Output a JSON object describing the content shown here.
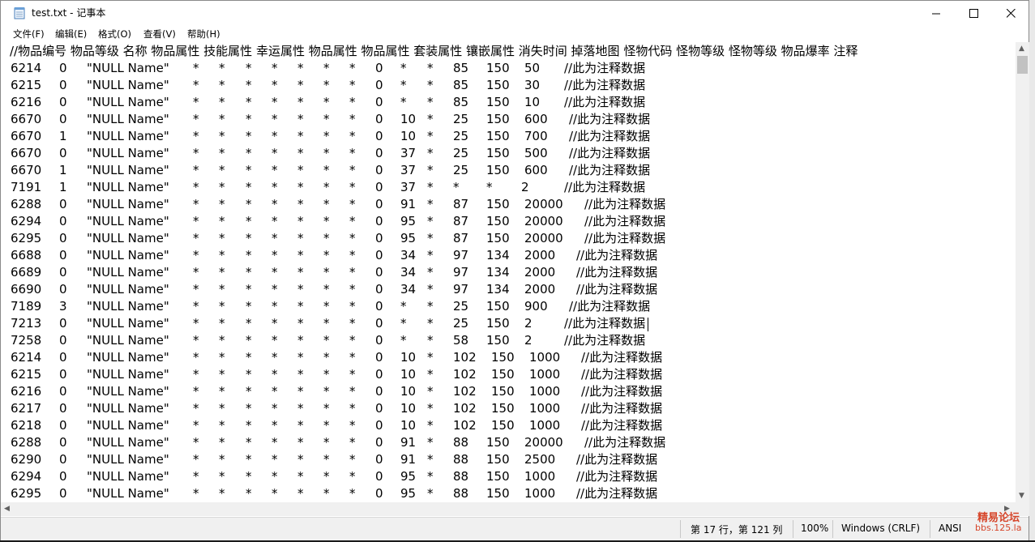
{
  "window": {
    "title": "test.txt - 记事本",
    "controls": {
      "minimize": "minimize-icon",
      "maximize": "maximize-icon",
      "close": "close-icon"
    }
  },
  "menu": [
    "文件(F)",
    "编辑(E)",
    "格式(O)",
    "查看(V)",
    "帮助(H)"
  ],
  "header_line": "//物品编号 物品等级 名称 物品属性 技能属性 幸运属性 物品属性 物品属性 套装属性 镶嵌属性 消失时间 掉落地图 怪物代码 怪物等级 怪物等级 物品爆率 注释",
  "rows": [
    [
      "6214",
      "0",
      "\"NULL Name\"",
      "*",
      "*",
      "*",
      "*",
      "*",
      "*",
      "*",
      "0",
      "*",
      "*",
      "85",
      "150",
      "50",
      "//此为注释数据"
    ],
    [
      "6215",
      "0",
      "\"NULL Name\"",
      "*",
      "*",
      "*",
      "*",
      "*",
      "*",
      "*",
      "0",
      "*",
      "*",
      "85",
      "150",
      "30",
      "//此为注释数据"
    ],
    [
      "6216",
      "0",
      "\"NULL Name\"",
      "*",
      "*",
      "*",
      "*",
      "*",
      "*",
      "*",
      "0",
      "*",
      "*",
      "85",
      "150",
      "10",
      "//此为注释数据"
    ],
    [
      "6670",
      "0",
      "\"NULL Name\"",
      "*",
      "*",
      "*",
      "*",
      "*",
      "*",
      "*",
      "0",
      "10",
      "*",
      "25",
      "150",
      "600",
      "//此为注释数据"
    ],
    [
      "6670",
      "1",
      "\"NULL Name\"",
      "*",
      "*",
      "*",
      "*",
      "*",
      "*",
      "*",
      "0",
      "10",
      "*",
      "25",
      "150",
      "700",
      "//此为注释数据"
    ],
    [
      "6670",
      "0",
      "\"NULL Name\"",
      "*",
      "*",
      "*",
      "*",
      "*",
      "*",
      "*",
      "0",
      "37",
      "*",
      "25",
      "150",
      "500",
      "//此为注释数据"
    ],
    [
      "6670",
      "1",
      "\"NULL Name\"",
      "*",
      "*",
      "*",
      "*",
      "*",
      "*",
      "*",
      "0",
      "37",
      "*",
      "25",
      "150",
      "600",
      "//此为注释数据"
    ],
    [
      "7191",
      "1",
      "\"NULL Name\"",
      "*",
      "*",
      "*",
      "*",
      "*",
      "*",
      "*",
      "0",
      "37",
      "*",
      "*",
      "*",
      "2",
      "//此为注释数据"
    ],
    [
      "6288",
      "0",
      "\"NULL Name\"",
      "*",
      "*",
      "*",
      "*",
      "*",
      "*",
      "*",
      "0",
      "91",
      "*",
      "87",
      "150",
      "20000",
      "//此为注释数据"
    ],
    [
      "6294",
      "0",
      "\"NULL Name\"",
      "*",
      "*",
      "*",
      "*",
      "*",
      "*",
      "*",
      "0",
      "95",
      "*",
      "87",
      "150",
      "20000",
      "//此为注释数据"
    ],
    [
      "6295",
      "0",
      "\"NULL Name\"",
      "*",
      "*",
      "*",
      "*",
      "*",
      "*",
      "*",
      "0",
      "95",
      "*",
      "87",
      "150",
      "20000",
      "//此为注释数据"
    ],
    [
      "6688",
      "0",
      "\"NULL Name\"",
      "*",
      "*",
      "*",
      "*",
      "*",
      "*",
      "*",
      "0",
      "34",
      "*",
      "97",
      "134",
      "2000",
      "//此为注释数据"
    ],
    [
      "6689",
      "0",
      "\"NULL Name\"",
      "*",
      "*",
      "*",
      "*",
      "*",
      "*",
      "*",
      "0",
      "34",
      "*",
      "97",
      "134",
      "2000",
      "//此为注释数据"
    ],
    [
      "6690",
      "0",
      "\"NULL Name\"",
      "*",
      "*",
      "*",
      "*",
      "*",
      "*",
      "*",
      "0",
      "34",
      "*",
      "97",
      "134",
      "2000",
      "//此为注释数据"
    ],
    [
      "7189",
      "3",
      "\"NULL Name\"",
      "*",
      "*",
      "*",
      "*",
      "*",
      "*",
      "*",
      "0",
      "*",
      "*",
      "25",
      "150",
      "900",
      "//此为注释数据"
    ],
    [
      "7213",
      "0",
      "\"NULL Name\"",
      "*",
      "*",
      "*",
      "*",
      "*",
      "*",
      "*",
      "0",
      "*",
      "*",
      "25",
      "150",
      "2",
      "//此为注释数据"
    ],
    [
      "7258",
      "0",
      "\"NULL Name\"",
      "*",
      "*",
      "*",
      "*",
      "*",
      "*",
      "*",
      "0",
      "*",
      "*",
      "58",
      "150",
      "2",
      "//此为注释数据"
    ],
    [
      "6214",
      "0",
      "\"NULL Name\"",
      "*",
      "*",
      "*",
      "*",
      "*",
      "*",
      "*",
      "0",
      "10",
      "*",
      "102",
      "150",
      "1000",
      "//此为注释数据"
    ],
    [
      "6215",
      "0",
      "\"NULL Name\"",
      "*",
      "*",
      "*",
      "*",
      "*",
      "*",
      "*",
      "0",
      "10",
      "*",
      "102",
      "150",
      "1000",
      "//此为注释数据"
    ],
    [
      "6216",
      "0",
      "\"NULL Name\"",
      "*",
      "*",
      "*",
      "*",
      "*",
      "*",
      "*",
      "0",
      "10",
      "*",
      "102",
      "150",
      "1000",
      "//此为注释数据"
    ],
    [
      "6217",
      "0",
      "\"NULL Name\"",
      "*",
      "*",
      "*",
      "*",
      "*",
      "*",
      "*",
      "0",
      "10",
      "*",
      "102",
      "150",
      "1000",
      "//此为注释数据"
    ],
    [
      "6218",
      "0",
      "\"NULL Name\"",
      "*",
      "*",
      "*",
      "*",
      "*",
      "*",
      "*",
      "0",
      "10",
      "*",
      "102",
      "150",
      "1000",
      "//此为注释数据"
    ],
    [
      "6288",
      "0",
      "\"NULL Name\"",
      "*",
      "*",
      "*",
      "*",
      "*",
      "*",
      "*",
      "0",
      "91",
      "*",
      "88",
      "150",
      "20000",
      "//此为注释数据"
    ],
    [
      "6290",
      "0",
      "\"NULL Name\"",
      "*",
      "*",
      "*",
      "*",
      "*",
      "*",
      "*",
      "0",
      "91",
      "*",
      "88",
      "150",
      "2500",
      "//此为注释数据"
    ],
    [
      "6294",
      "0",
      "\"NULL Name\"",
      "*",
      "*",
      "*",
      "*",
      "*",
      "*",
      "*",
      "0",
      "95",
      "*",
      "88",
      "150",
      "1000",
      "//此为注释数据"
    ],
    [
      "6295",
      "0",
      "\"NULL Name\"",
      "*",
      "*",
      "*",
      "*",
      "*",
      "*",
      "*",
      "0",
      "95",
      "*",
      "88",
      "150",
      "1000",
      "//此为注释数据"
    ]
  ],
  "status": {
    "position": "第 17 行，第 121 列",
    "zoom": "100%",
    "line_ending": "Windows (CRLF)",
    "encoding": "ANSI"
  },
  "watermark": {
    "line1": "精易论坛",
    "line2": "bbs.125.la"
  }
}
